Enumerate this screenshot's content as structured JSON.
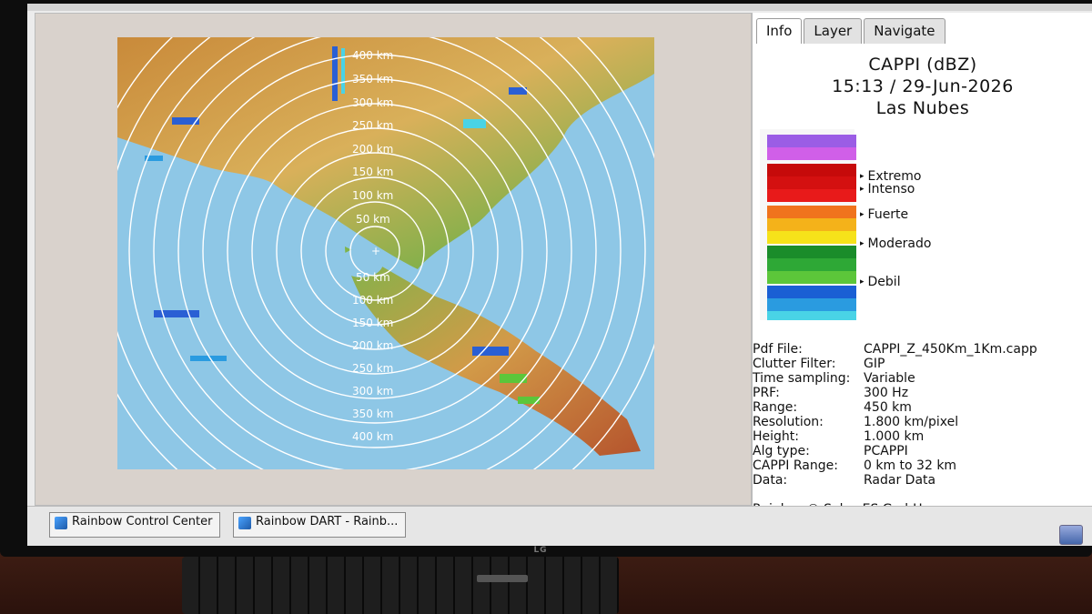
{
  "colors": {
    "ocean": "#8ec7e6",
    "ring": "#ffffff"
  },
  "tabs": [
    {
      "label": "Info"
    },
    {
      "label": "Layer"
    },
    {
      "label": "Navigate"
    }
  ],
  "header": {
    "product": "CAPPI (dBZ)",
    "datetime": "15:13 / 29-Jun-2026",
    "site": "Las Nubes"
  },
  "map": {
    "ring_labels_north": [
      "400 km",
      "350 km",
      "300 km",
      "250 km",
      "200 km",
      "150 km",
      "100 km",
      "50 km"
    ],
    "ring_labels_south": [
      "50 km",
      "100 km",
      "150 km",
      "200 km",
      "250 km",
      "300 km",
      "350 km",
      "400 km"
    ]
  },
  "scale": {
    "swatches": [
      "#9b5de5",
      "#d05fe8",
      "#c60a0a",
      "#d41010",
      "#e81a1a",
      "#f0731d",
      "#f4b21a",
      "#f6e21a",
      "#1a8c2a",
      "#2ea836",
      "#5cc63a",
      "#1a5fd4",
      "#2a9be0",
      "#49d3e6"
    ],
    "labels": [
      "Extremo",
      "Intenso",
      "Fuerte",
      "Moderado",
      "Debil"
    ]
  },
  "info": {
    "pdf_file_label": "Pdf File:",
    "pdf_file_value": "CAPPI_Z_450Km_1Km.capp",
    "clutter_label": "Clutter Filter:",
    "clutter_value": "GIP",
    "time_sampling_label": "Time sampling:",
    "time_sampling_value": "Variable",
    "prf_label": "PRF:",
    "prf_value": "300 Hz",
    "range_label": "Range:",
    "range_value": "450 km",
    "resolution_label": "Resolution:",
    "resolution_value": "1.800 km/pixel",
    "height_label": "Height:",
    "height_value": "1.000 km",
    "alg_label": "Alg type:",
    "alg_value": "PCAPPI",
    "cappi_range_label": "CAPPI Range:",
    "cappi_range_value": "0 km to 32 km",
    "data_label": "Data:",
    "data_value": "Radar Data",
    "footer": "Rainbow® Selex ES GmbH"
  },
  "taskbar": {
    "items": [
      "Rainbow Control Center",
      "Rainbow DART - Rainb..."
    ]
  },
  "monitor": {
    "brand": "LG"
  }
}
